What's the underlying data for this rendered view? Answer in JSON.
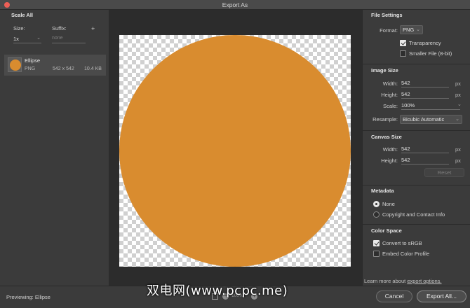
{
  "window": {
    "title": "Export As"
  },
  "left": {
    "scale_all": "Scale All",
    "size_label": "Size:",
    "suffix_label": "Suffix:",
    "add_symbol": "+",
    "size_value": "1x",
    "suffix_placeholder": "none",
    "asset": {
      "name": "Ellipse",
      "format": "PNG",
      "dimensions": "542 x 542",
      "file_size": "10.4 KB"
    }
  },
  "preview": {
    "shape_color": "#d98c2f"
  },
  "file_settings": {
    "header": "File Settings",
    "format_label": "Format:",
    "format_value": "PNG",
    "transparency_label": "Transparency",
    "transparency_checked": true,
    "smaller_file_label": "Smaller File (8-bit)",
    "smaller_file_checked": false
  },
  "image_size": {
    "header": "Image Size",
    "width_label": "Width:",
    "width_value": "542",
    "height_label": "Height:",
    "height_value": "542",
    "unit": "px",
    "scale_label": "Scale:",
    "scale_value": "100%",
    "resample_label": "Resample:",
    "resample_value": "Bicubic Automatic"
  },
  "canvas_size": {
    "header": "Canvas Size",
    "width_label": "Width:",
    "width_value": "542",
    "height_label": "Height:",
    "height_value": "542",
    "unit": "px",
    "reset_label": "Reset"
  },
  "metadata": {
    "header": "Metadata",
    "none_label": "None",
    "copyright_label": "Copyright and Contact Info",
    "selected": "None"
  },
  "color_space": {
    "header": "Color Space",
    "convert_label": "Convert to sRGB",
    "convert_checked": true,
    "embed_label": "Embed Color Profile",
    "embed_checked": false
  },
  "footer": {
    "previewing": "Previewing: Ellipse",
    "zoom_value": "100%",
    "learn_more_text": "Learn more about",
    "learn_more_link": "export options.",
    "cancel": "Cancel",
    "export_all": "Export All..."
  },
  "watermark": "双电网(www.pcpc.me)"
}
